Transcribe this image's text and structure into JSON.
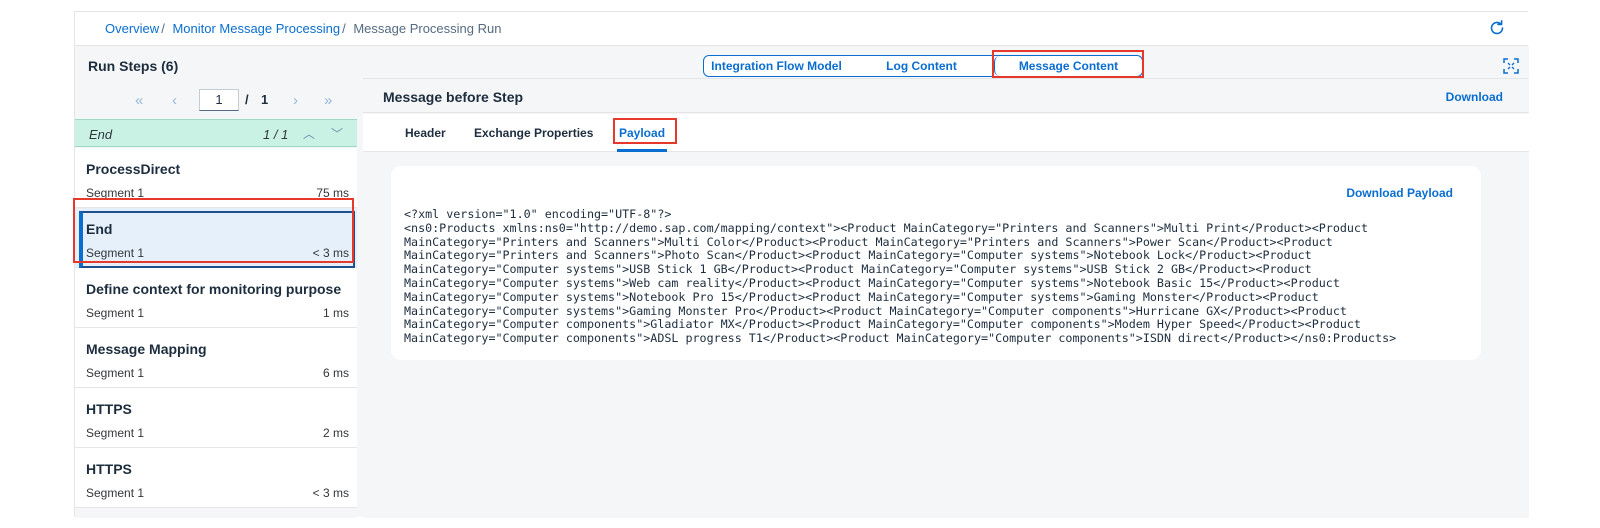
{
  "breadcrumb": {
    "items": [
      "Overview",
      "Monitor Message Processing"
    ],
    "separator": "/",
    "current": "Message Processing Run"
  },
  "icons": {
    "refresh": "refresh-icon",
    "fullscreen": "fullscreen-icon",
    "first": "«",
    "prev": "‹",
    "next": "›",
    "last": "»",
    "up": "︿",
    "down": "﹀"
  },
  "run_steps": {
    "title": "Run Steps (6)",
    "pager": {
      "page": "1",
      "slash": "/",
      "total": "1"
    },
    "search": {
      "term": "End",
      "count": "1 / 1"
    },
    "items": [
      {
        "name": "ProcessDirect",
        "segment": "Segment 1",
        "duration": "75 ms"
      },
      {
        "name": "End",
        "segment": "Segment 1",
        "duration": "< 3 ms"
      },
      {
        "name": "Define context for monitoring purpose",
        "segment": "Segment 1",
        "duration": "1 ms"
      },
      {
        "name": "Message Mapping",
        "segment": "Segment 1",
        "duration": "6 ms"
      },
      {
        "name": "HTTPS",
        "segment": "Segment 1",
        "duration": "2 ms"
      },
      {
        "name": "HTTPS",
        "segment": "Segment 1",
        "duration": "< 3 ms"
      }
    ],
    "selected_index": 1
  },
  "view_switch": {
    "options": [
      "Integration Flow Model",
      "Log Content",
      "Message Content"
    ],
    "selected": "Message Content"
  },
  "message": {
    "title": "Message before Step",
    "download": "Download",
    "tabs": [
      "Header",
      "Exchange Properties",
      "Payload"
    ],
    "active_tab": "Payload",
    "download_payload": "Download Payload",
    "payload": "<?xml version=\"1.0\" encoding=\"UTF-8\"?>\n<ns0:Products xmlns:ns0=\"http://demo.sap.com/mapping/context\"><Product MainCategory=\"Printers and Scanners\">Multi Print</Product><Product\nMainCategory=\"Printers and Scanners\">Multi Color</Product><Product MainCategory=\"Printers and Scanners\">Power Scan</Product><Product\nMainCategory=\"Printers and Scanners\">Photo Scan</Product><Product MainCategory=\"Computer systems\">Notebook Lock</Product><Product\nMainCategory=\"Computer systems\">USB Stick 1 GB</Product><Product MainCategory=\"Computer systems\">USB Stick 2 GB</Product><Product\nMainCategory=\"Computer systems\">Web cam reality</Product><Product MainCategory=\"Computer systems\">Notebook Basic 15</Product><Product\nMainCategory=\"Computer systems\">Notebook Pro 15</Product><Product MainCategory=\"Computer systems\">Gaming Monster</Product><Product\nMainCategory=\"Computer systems\">Gaming Monster Pro</Product><Product MainCategory=\"Computer components\">Hurricane GX</Product><Product\nMainCategory=\"Computer components\">Gladiator MX</Product><Product MainCategory=\"Computer components\">Modem Hyper Speed</Product><Product\nMainCategory=\"Computer components\">ADSL progress T1</Product><Product MainCategory=\"Computer components\">ISDN direct</Product></ns0:Products>"
  },
  "colors": {
    "accent": "#0a6ed1",
    "highlight_border": "#e6392b",
    "search_match_bg": "#c9f2e4",
    "selected_bg": "#e5f0fa"
  }
}
